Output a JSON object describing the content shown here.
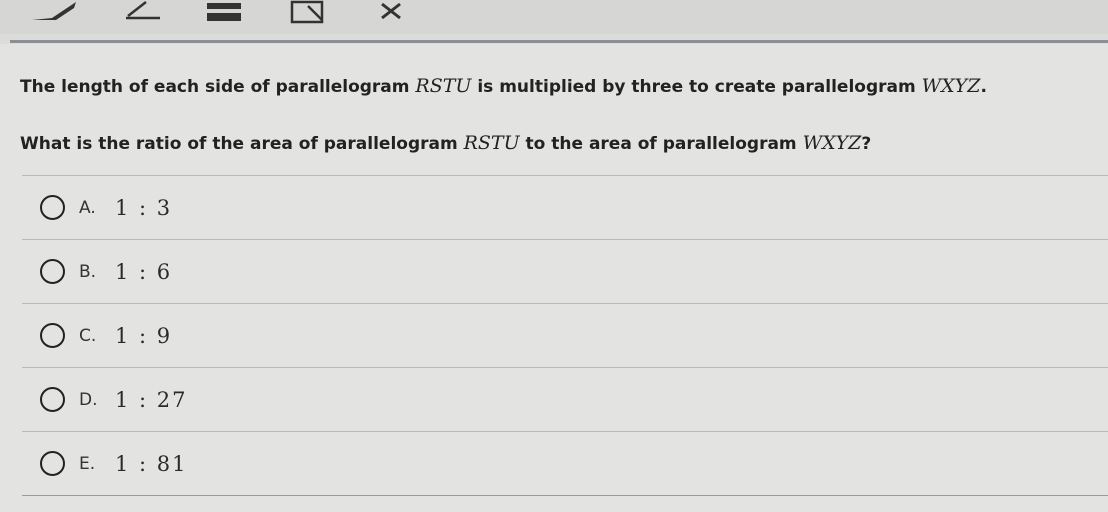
{
  "question": {
    "line1_prefix": "The length of each side of parallelogram ",
    "line1_shape1": "RSTU",
    "line1_mid": " is multiplied by three to create parallelogram ",
    "line1_shape2": "WXYZ",
    "line1_end": ".",
    "line2_prefix": "What is the ratio of the area of parallelogram ",
    "line2_shape1": "RSTU",
    "line2_mid": " to the area of parallelogram ",
    "line2_shape2": "WXYZ",
    "line2_end": "?"
  },
  "choices": [
    {
      "letter": "A.",
      "value": "1 : 3"
    },
    {
      "letter": "B.",
      "value": "1 : 6"
    },
    {
      "letter": "C.",
      "value": "1 : 9"
    },
    {
      "letter": "D.",
      "value": "1 : 27"
    },
    {
      "letter": "E.",
      "value": "1 : 81"
    }
  ]
}
